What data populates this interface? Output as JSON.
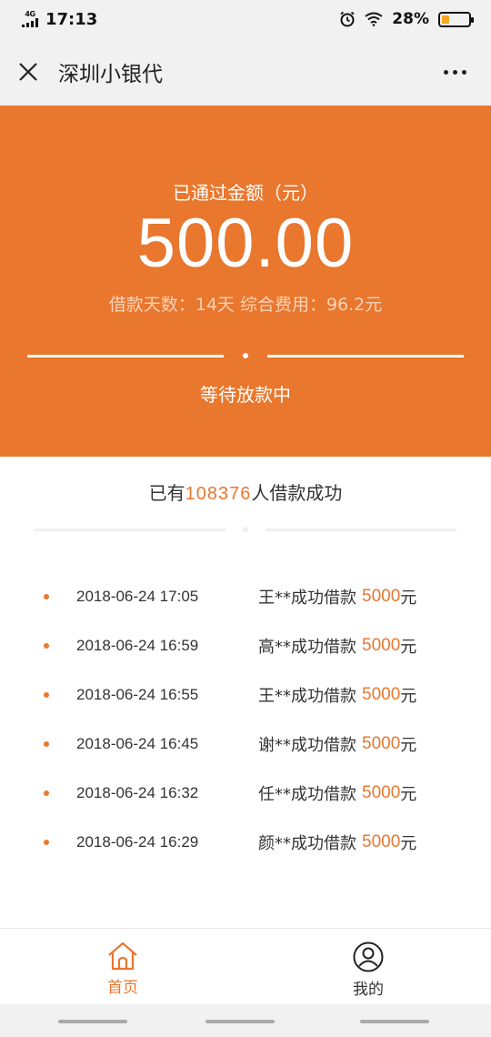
{
  "status_bar": {
    "network": "4G",
    "time": "17:13",
    "battery_percent": "28%",
    "battery_level": 0.28
  },
  "header": {
    "title": "深圳小银代",
    "close_icon": "close-icon",
    "more_icon": "more-icon"
  },
  "hero": {
    "label": "已通过金额（元）",
    "amount": "500.00",
    "terms": "借款天数：14天 综合费用：96.2元",
    "status": "等待放款中"
  },
  "stats": {
    "prefix": "已有",
    "count": "108376",
    "suffix": "人借款成功"
  },
  "records": [
    {
      "date": "2018-06-24 17:05",
      "desc": "王**成功借款",
      "amount": "5000",
      "unit": "元"
    },
    {
      "date": "2018-06-24 16:59",
      "desc": "高**成功借款",
      "amount": "5000",
      "unit": "元"
    },
    {
      "date": "2018-06-24 16:55",
      "desc": "王**成功借款",
      "amount": "5000",
      "unit": "元"
    },
    {
      "date": "2018-06-24 16:45",
      "desc": "谢**成功借款",
      "amount": "5000",
      "unit": "元"
    },
    {
      "date": "2018-06-24 16:32",
      "desc": "任**成功借款",
      "amount": "5000",
      "unit": "元"
    },
    {
      "date": "2018-06-24 16:29",
      "desc": "颜**成功借款",
      "amount": "5000",
      "unit": "元"
    }
  ],
  "bottom_nav": {
    "items": [
      {
        "label": "首页",
        "icon": "home-icon",
        "active": true
      },
      {
        "label": "我的",
        "icon": "user-icon",
        "active": false
      }
    ]
  },
  "colors": {
    "accent": "#e9772e",
    "header_bg": "#f1f1f1"
  }
}
